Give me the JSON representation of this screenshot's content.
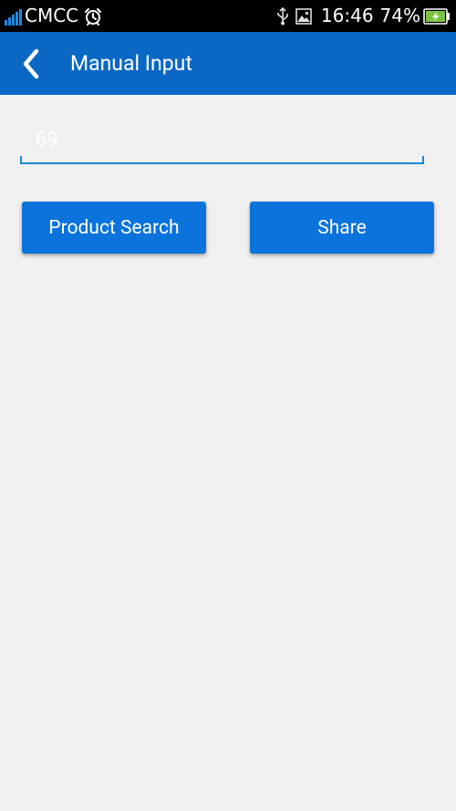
{
  "status_bar": {
    "carrier": "CMCC",
    "time": "16:46",
    "battery_percent": "74%",
    "icons": [
      "signal-icon",
      "alarm-icon",
      "usb-icon",
      "gallery-icon",
      "battery-charging-icon"
    ]
  },
  "app_bar": {
    "title": "Manual Input",
    "back_icon": "back-chevron-icon"
  },
  "input": {
    "value": "69"
  },
  "buttons": {
    "product_search": "Product Search",
    "share": "Share"
  },
  "colors": {
    "app_bar": "#0a68c4",
    "button": "#0a73dc",
    "underline": "#1a8ad6",
    "background": "#f0f0f0",
    "signal": "#1e88e5",
    "battery": "#7ec242"
  }
}
